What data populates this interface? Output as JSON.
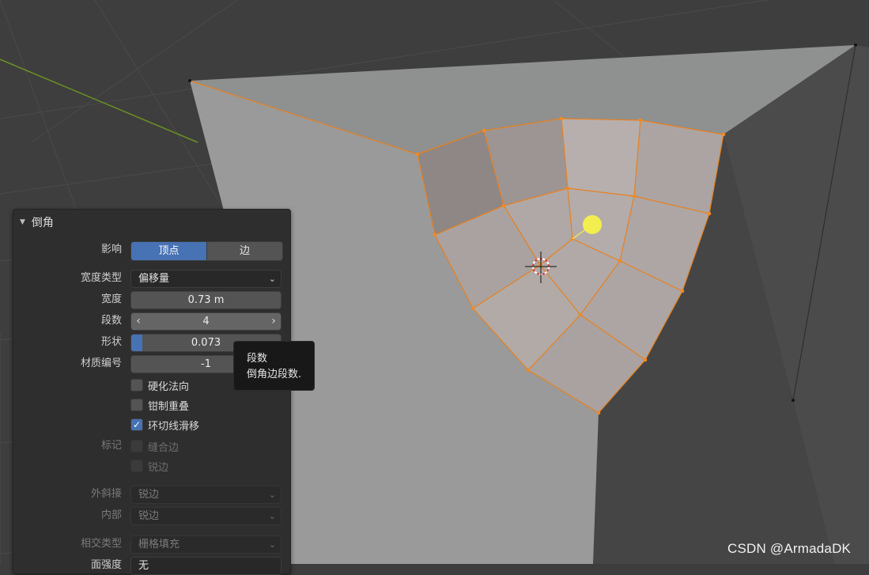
{
  "panel": {
    "title": "倒角",
    "affect": {
      "label": "影响",
      "options": [
        "顶点",
        "边"
      ],
      "selected": "顶点"
    },
    "width_type": {
      "label": "宽度类型",
      "value": "偏移量"
    },
    "width": {
      "label": "宽度",
      "value": "0.73 m"
    },
    "segments": {
      "label": "段数",
      "value": "4"
    },
    "shape": {
      "label": "形状",
      "value": "0.073",
      "fraction": 0.073
    },
    "material_index": {
      "label": "材质编号",
      "value": "-1"
    },
    "harden_normals": {
      "label": "硬化法向",
      "checked": false
    },
    "clamp_overlap": {
      "label": "钳制重叠",
      "checked": false
    },
    "loop_slide": {
      "label": "环切线滑移",
      "checked": true
    },
    "mark": {
      "label": "标记",
      "seam": "缝合边",
      "sharp": "锐边"
    },
    "miter_outer": {
      "label": "外斜接",
      "value": "锐边"
    },
    "miter_inner": {
      "label": "内部",
      "value": "锐边"
    },
    "intersection_type": {
      "label": "相交类型",
      "value": "栅格填充"
    },
    "face_strength": {
      "label": "面强度",
      "value": "无"
    }
  },
  "tooltip": {
    "title": "段数",
    "description": "倒角边段数."
  },
  "watermark": "CSDN @ArmadaDK",
  "colors": {
    "accent": "#4772b3",
    "panel_bg": "#2e2e2e",
    "selection_edge": "#e8801d",
    "light_gizmo": "#f2ee4f"
  }
}
